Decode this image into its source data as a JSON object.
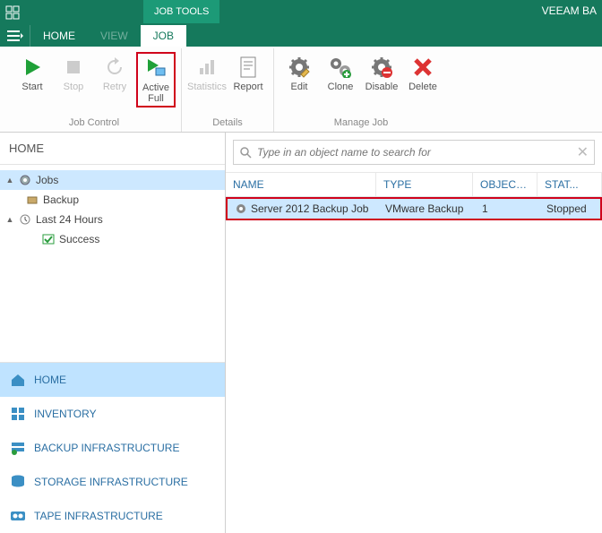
{
  "title_bar": {
    "job_tools_label": "JOB TOOLS",
    "product_name": "VEEAM BA"
  },
  "tabs": {
    "home": "HOME",
    "view": "VIEW",
    "job": "JOB"
  },
  "ribbon": {
    "job_control": {
      "label": "Job Control",
      "start": "Start",
      "stop": "Stop",
      "retry": "Retry",
      "active_full": "Active\nFull"
    },
    "details": {
      "label": "Details",
      "statistics": "Statistics",
      "report": "Report"
    },
    "manage_job": {
      "label": "Manage Job",
      "edit": "Edit",
      "clone": "Clone",
      "disable": "Disable",
      "delete": "Delete"
    }
  },
  "left": {
    "header": "HOME",
    "tree": {
      "jobs": "Jobs",
      "backup": "Backup",
      "last24": "Last 24 Hours",
      "success": "Success"
    },
    "nav": {
      "home": "HOME",
      "inventory": "INVENTORY",
      "backup_infra": "BACKUP INFRASTRUCTURE",
      "storage_infra": "STORAGE INFRASTRUCTURE",
      "tape_infra": "TAPE INFRASTRUCTURE"
    }
  },
  "search": {
    "placeholder": "Type in an object name to search for"
  },
  "grid": {
    "columns": {
      "name": "NAME",
      "type": "TYPE",
      "objects": "OBJECTS",
      "status": "STAT..."
    },
    "rows": [
      {
        "name": "Server 2012 Backup Job",
        "type": "VMware Backup",
        "objects": "1",
        "status": "Stopped"
      }
    ]
  }
}
